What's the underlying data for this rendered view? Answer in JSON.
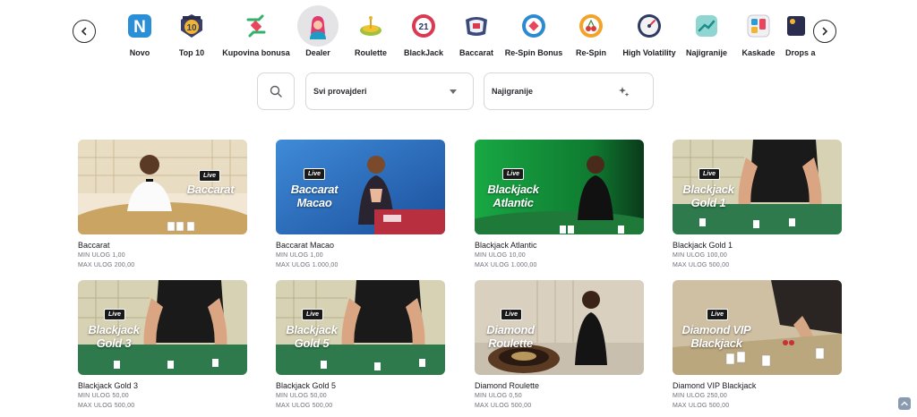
{
  "categories": [
    {
      "label": "Novo",
      "icon": "new-n-icon",
      "active": false
    },
    {
      "label": "Top 10",
      "icon": "top10-badge-icon",
      "active": false
    },
    {
      "label": "Kupovina bonusa",
      "icon": "buy-bonus-icon",
      "active": false
    },
    {
      "label": "Dealer",
      "icon": "dealer-icon",
      "active": true
    },
    {
      "label": "Roulette",
      "icon": "roulette-icon",
      "active": false
    },
    {
      "label": "BlackJack",
      "icon": "blackjack-21-icon",
      "active": false
    },
    {
      "label": "Baccarat",
      "icon": "baccarat-icon",
      "active": false
    },
    {
      "label": "Re-Spin Bonus",
      "icon": "respin-bonus-icon",
      "active": false
    },
    {
      "label": "Re-Spin",
      "icon": "cherry-icon",
      "active": false
    },
    {
      "label": "High Volatility",
      "icon": "gauge-icon",
      "active": false
    },
    {
      "label": "Najigranije",
      "icon": "trend-icon",
      "active": false
    },
    {
      "label": "Kaskade",
      "icon": "cascade-icon",
      "active": false
    },
    {
      "label": "Drops a",
      "icon": "drops-icon",
      "active": false
    }
  ],
  "filters": {
    "providers": "Svi provajderi",
    "sort": "Najigranije"
  },
  "games": [
    {
      "name": "Baccarat",
      "min": "MIN ULOG 1,00",
      "max": "MAX ULOG 200,00",
      "badge": "Live",
      "thumb_title": "Baccarat"
    },
    {
      "name": "Baccarat Macao",
      "min": "MIN ULOG 1,00",
      "max": "MAX ULOG 1.000,00",
      "badge": "Live",
      "thumb_title": "Baccarat Macao"
    },
    {
      "name": "Blackjack Atlantic",
      "min": "MIN ULOG 10,00",
      "max": "MAX ULOG 1.000,00",
      "badge": "Live",
      "thumb_title": "Blackjack Atlantic"
    },
    {
      "name": "Blackjack Gold 1",
      "min": "MIN ULOG 100,00",
      "max": "MAX ULOG 500,00",
      "badge": "Live",
      "thumb_title": "Blackjack Gold 1"
    },
    {
      "name": "Blackjack Gold 3",
      "min": "MIN ULOG 50,00",
      "max": "MAX ULOG 500,00",
      "badge": "Live",
      "thumb_title": "Blackjack Gold 3"
    },
    {
      "name": "Blackjack Gold 5",
      "min": "MIN ULOG 50,00",
      "max": "MAX ULOG 500,00",
      "badge": "Live",
      "thumb_title": "Blackjack Gold 5"
    },
    {
      "name": "Diamond Roulette",
      "min": "MIN ULOG 0,50",
      "max": "MAX ULOG 500,00",
      "badge": "Live",
      "thumb_title": "Diamond Roulette"
    },
    {
      "name": "Diamond VIP Blackjack",
      "min": "MIN ULOG 250,00",
      "max": "MAX ULOG 500,00",
      "badge": "Live",
      "thumb_title": "Diamond VIP Blackjack"
    }
  ]
}
